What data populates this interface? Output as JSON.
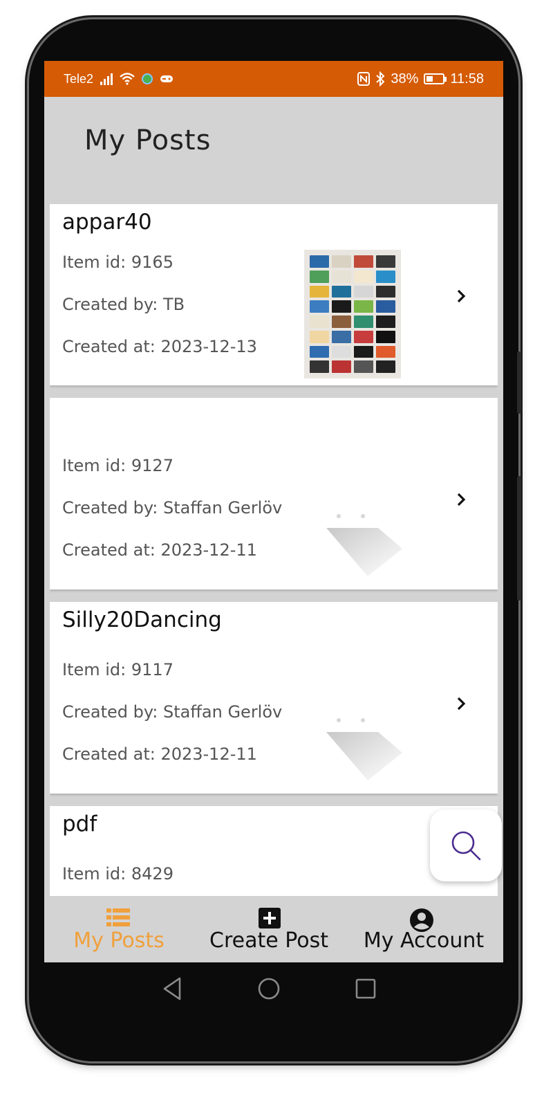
{
  "status_bar": {
    "carrier": "Tele2",
    "battery": "38%",
    "time": "11:58",
    "icons": [
      "signal-icon",
      "wifi-icon",
      "globe-icon",
      "controller-icon",
      "nfc-icon",
      "bluetooth-icon",
      "battery-icon"
    ]
  },
  "header": {
    "title": "My Posts"
  },
  "posts": [
    {
      "title": "appar40",
      "item_id": "Item id: 9165",
      "created_by": "Created by: TB",
      "created_at": "Created at: 2023-12-13",
      "image": "poster-thumbnail"
    },
    {
      "title": "",
      "item_id": "Item id: 9127",
      "created_by": "Created by: Staffan Gerlöv",
      "created_at": "Created at: 2023-12-11",
      "image": "placeholder-icon"
    },
    {
      "title": "Silly20Dancing",
      "item_id": "Item id: 9117",
      "created_by": "Created by: Staffan Gerlöv",
      "created_at": "Created at: 2023-12-11",
      "image": "placeholder-icon"
    },
    {
      "title": "pdf",
      "item_id": "Item id: 8429"
    }
  ],
  "fab": {
    "icon": "search-icon"
  },
  "bottom_nav": {
    "items": [
      {
        "label": "My Posts",
        "icon": "list-icon",
        "active": true
      },
      {
        "label": "Create Post",
        "icon": "add-box-icon",
        "active": false
      },
      {
        "label": "My Account",
        "icon": "account-circle-icon",
        "active": false
      }
    ]
  },
  "colors": {
    "status_bar": "#d55b05",
    "background": "#d3d3d3",
    "active_nav": "#f0a03c",
    "fab_icon": "#4b2d8f"
  }
}
